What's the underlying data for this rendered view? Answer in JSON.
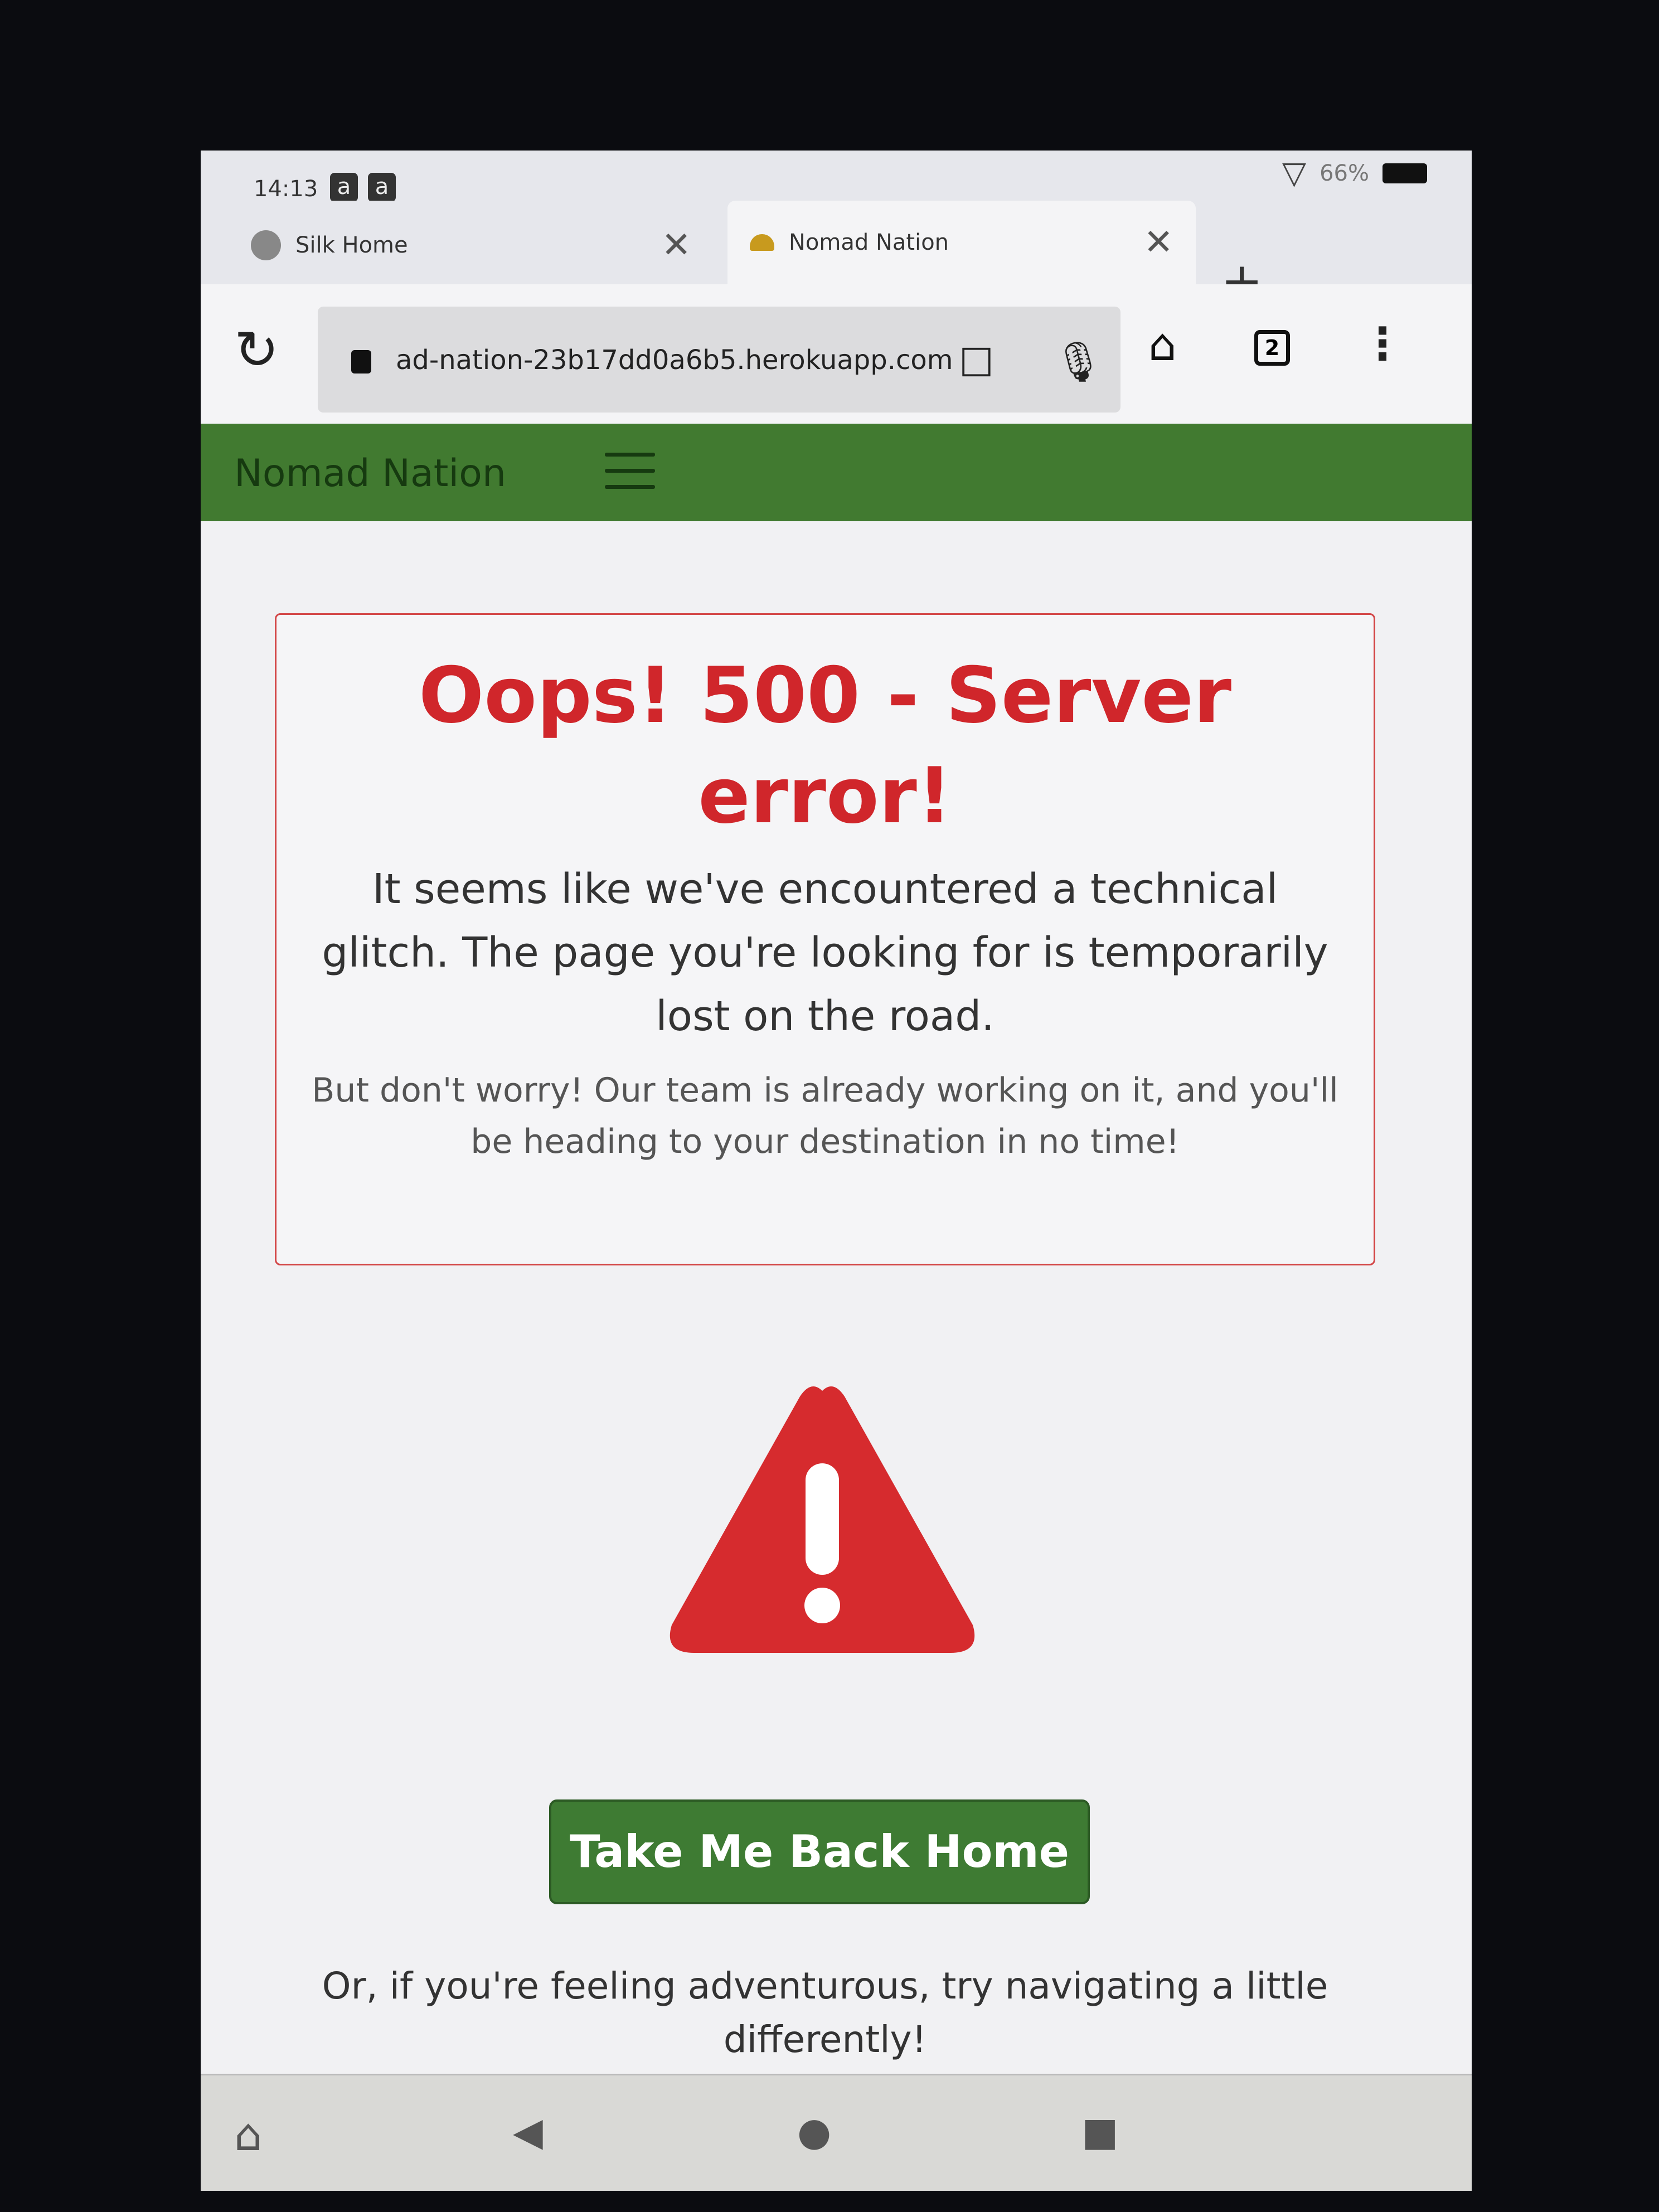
{
  "status_bar": {
    "time": "14:13",
    "notif_icons": [
      "a",
      "a"
    ],
    "battery": "66%",
    "icons": [
      "amazon-icon",
      "amazon-icon",
      "wifi-icon",
      "battery-icon"
    ]
  },
  "tabs": [
    {
      "label": "Silk Home",
      "icon": "globe-icon"
    },
    {
      "label": "Nomad Nation",
      "icon": "favicon",
      "active": true
    }
  ],
  "address_bar": {
    "url": "ad-nation-23b17dd0a6b5.herokuapp.com",
    "tab_count": "2"
  },
  "navbar": {
    "brand": "Nomad Nation",
    "bg_color": "#417a30"
  },
  "error_card": {
    "title": "Oops! 500 - Server error!",
    "message": "It seems like we've encountered a technical glitch. The page you're looking for is temporarily lost on the road.",
    "reassurance": "But don't worry! Our team is already working on it, and you'll be heading to your destination in no time!",
    "accent_color": "#d0262b"
  },
  "warning_icon": "warning-triangle-icon",
  "cta": {
    "label": "Take Me Back Home",
    "color": "#3e7b33"
  },
  "footer_text": "Or, if you're feeling adventurous, try navigating a little differently!",
  "system_nav": [
    "home-icon",
    "back-icon",
    "home-circle-icon",
    "recents-icon"
  ]
}
